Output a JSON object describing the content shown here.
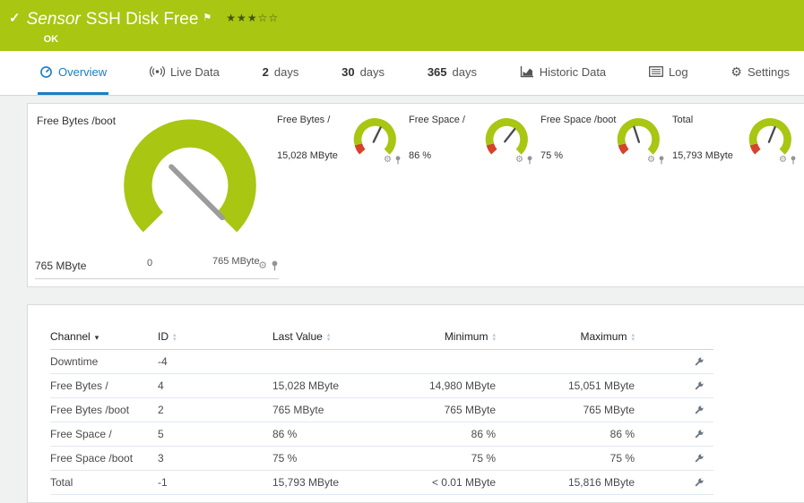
{
  "colors": {
    "brand_green": "#a8c612",
    "active_tab_blue": "#1a7ec2",
    "alert_red": "#d4432a"
  },
  "icons": {
    "check": "✓",
    "flag": "⚑",
    "gear": "⚙",
    "sort_desc": "▾",
    "sort_up": "▴",
    "sort_down": "▾"
  },
  "header": {
    "title_prefix": "Sensor",
    "title": "SSH Disk Free",
    "stars": "★★★☆☆",
    "status": "OK"
  },
  "tabs": {
    "overview": "Overview",
    "live_data": "Live Data",
    "d2_num": "2",
    "d2_label": "days",
    "d30_num": "30",
    "d30_label": "days",
    "d365_num": "365",
    "d365_label": "days",
    "historic": "Historic Data",
    "log": "Log",
    "settings": "Settings"
  },
  "gauges": {
    "main": {
      "title": "Free Bytes /boot",
      "value": "765 MByte",
      "scale_min": "0",
      "scale_max": "765 MByte"
    },
    "minis": [
      {
        "title": "Free Bytes /",
        "value": "15,028 MByte"
      },
      {
        "title": "Free Space /",
        "value": "86 %"
      },
      {
        "title": "Free Space /boot",
        "value": "75 %"
      },
      {
        "title": "Total",
        "value": "15,793 MByte"
      }
    ]
  },
  "table": {
    "headers": {
      "channel": "Channel",
      "id": "ID",
      "last_value": "Last Value",
      "minimum": "Minimum",
      "maximum": "Maximum"
    },
    "rows": [
      {
        "channel": "Downtime",
        "id": "-4",
        "last": "",
        "min": "",
        "max": ""
      },
      {
        "channel": "Free Bytes /",
        "id": "4",
        "last": "15,028 MByte",
        "min": "14,980 MByte",
        "max": "15,051 MByte"
      },
      {
        "channel": "Free Bytes /boot",
        "id": "2",
        "last": "765 MByte",
        "min": "765 MByte",
        "max": "765 MByte"
      },
      {
        "channel": "Free Space /",
        "id": "5",
        "last": "86 %",
        "min": "86 %",
        "max": "86 %"
      },
      {
        "channel": "Free Space /boot",
        "id": "3",
        "last": "75 %",
        "min": "75 %",
        "max": "75 %"
      },
      {
        "channel": "Total",
        "id": "-1",
        "last": "15,793 MByte",
        "min": "< 0.01 MByte",
        "max": "15,816 MByte"
      }
    ]
  }
}
